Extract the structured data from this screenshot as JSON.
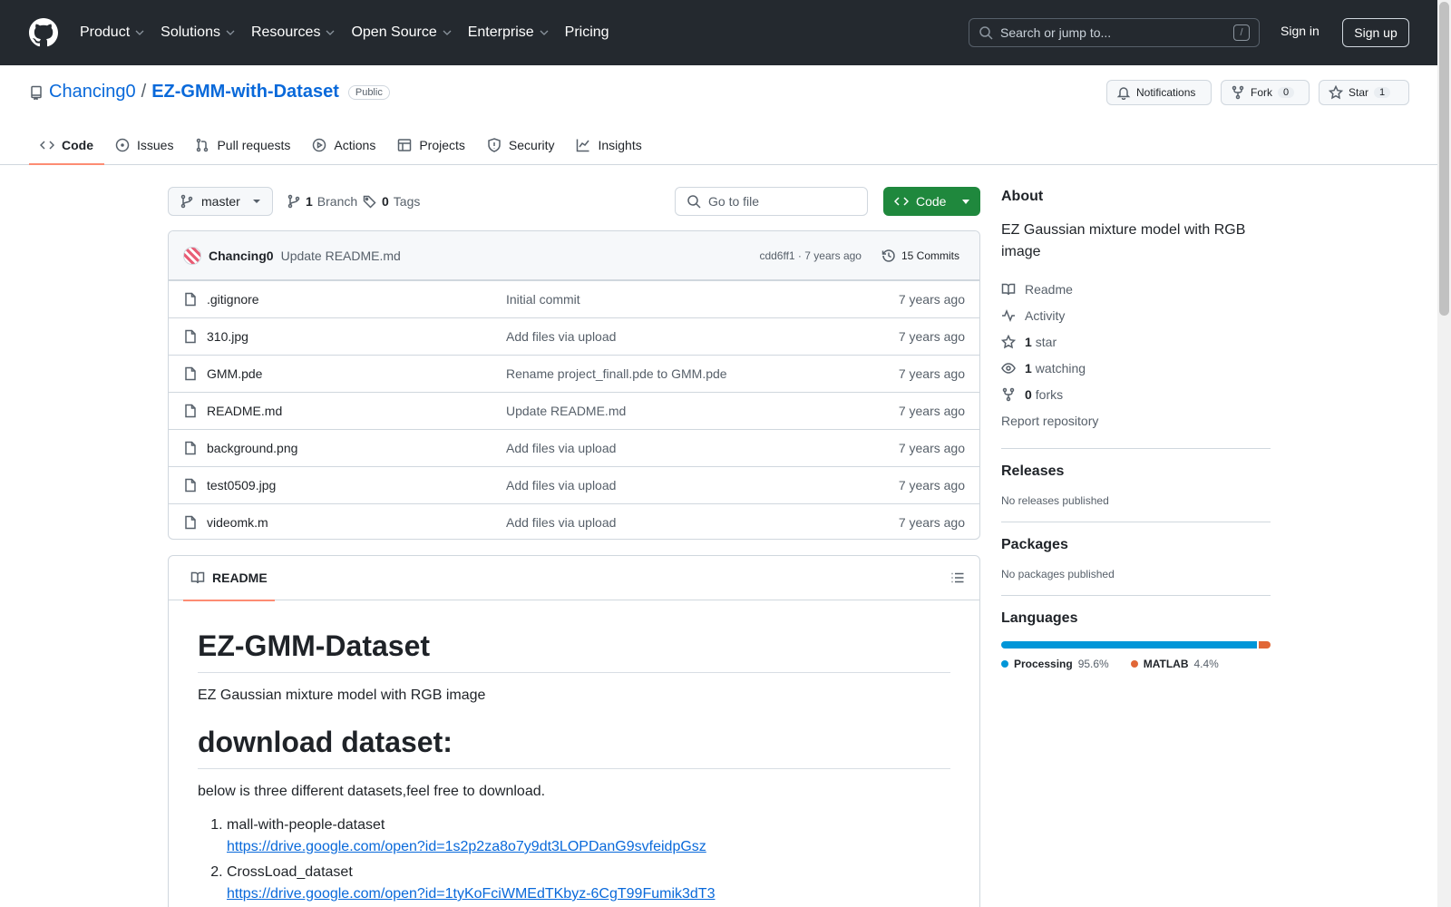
{
  "header": {
    "nav": [
      "Product",
      "Solutions",
      "Resources",
      "Open Source",
      "Enterprise",
      "Pricing"
    ],
    "search_placeholder": "Search or jump to...",
    "search_shortcut": "/",
    "signin": "Sign in",
    "signup": "Sign up"
  },
  "repo": {
    "owner": "Chancing0",
    "separator": "/",
    "name": "EZ-GMM-with-Dataset",
    "visibility": "Public",
    "notifications_label": "Notifications",
    "fork_label": "Fork",
    "fork_count": "0",
    "star_label": "Star",
    "star_count": "1"
  },
  "tabs": [
    "Code",
    "Issues",
    "Pull requests",
    "Actions",
    "Projects",
    "Security",
    "Insights"
  ],
  "toolbar": {
    "branch": "master",
    "branch_count": "1",
    "branch_label": "Branch",
    "tag_count": "0",
    "tag_label": "Tags",
    "goto_placeholder": "Go to file",
    "code_label": "Code"
  },
  "commit": {
    "user": "Chancing0",
    "message": "Update README.md",
    "meta": "cdd6ff1 · 7 years ago",
    "count": "15 Commits"
  },
  "files": [
    {
      "name": ".gitignore",
      "message": "Initial commit",
      "age": "7 years ago"
    },
    {
      "name": "310.jpg",
      "message": "Add files via upload",
      "age": "7 years ago"
    },
    {
      "name": "GMM.pde",
      "message": "Rename project_finall.pde to GMM.pde",
      "age": "7 years ago"
    },
    {
      "name": "README.md",
      "message": "Update README.md",
      "age": "7 years ago"
    },
    {
      "name": "background.png",
      "message": "Add files via upload",
      "age": "7 years ago"
    },
    {
      "name": "test0509.jpg",
      "message": "Add files via upload",
      "age": "7 years ago"
    },
    {
      "name": "videomk.m",
      "message": "Add files via upload",
      "age": "7 years ago"
    }
  ],
  "readme": {
    "tab": "README",
    "h1": "EZ-GMM-Dataset",
    "intro": "EZ Gaussian mixture model with RGB image",
    "h2": "download dataset:",
    "para": "below is three different datasets,feel free to download.",
    "items": [
      {
        "title": "mall-with-people-dataset",
        "link": "https://drive.google.com/open?id=1s2p2za8o7y9dt3LOPDanG9svfeidpGsz"
      },
      {
        "title": "CrossLoad_dataset",
        "link": "https://drive.google.com/open?id=1tyKoFciWMEdTKbyz-6CgT99Fumik3dT3"
      }
    ]
  },
  "about": {
    "title": "About",
    "description": "EZ Gaussian mixture model with RGB image",
    "readme": "Readme",
    "activity": "Activity",
    "stars_count": "1",
    "stars_label": "star",
    "watching_count": "1",
    "watching_label": "watching",
    "forks_count": "0",
    "forks_label": "forks",
    "report": "Report repository"
  },
  "releases": {
    "title": "Releases",
    "text": "No releases published"
  },
  "packages": {
    "title": "Packages",
    "text": "No packages published"
  },
  "languages": {
    "title": "Languages",
    "items": [
      {
        "name": "Processing",
        "percent": "95.6%",
        "value": 95.6,
        "color": "#0096D8"
      },
      {
        "name": "MATLAB",
        "percent": "4.4%",
        "value": 4.4,
        "color": "#e16737"
      }
    ]
  }
}
